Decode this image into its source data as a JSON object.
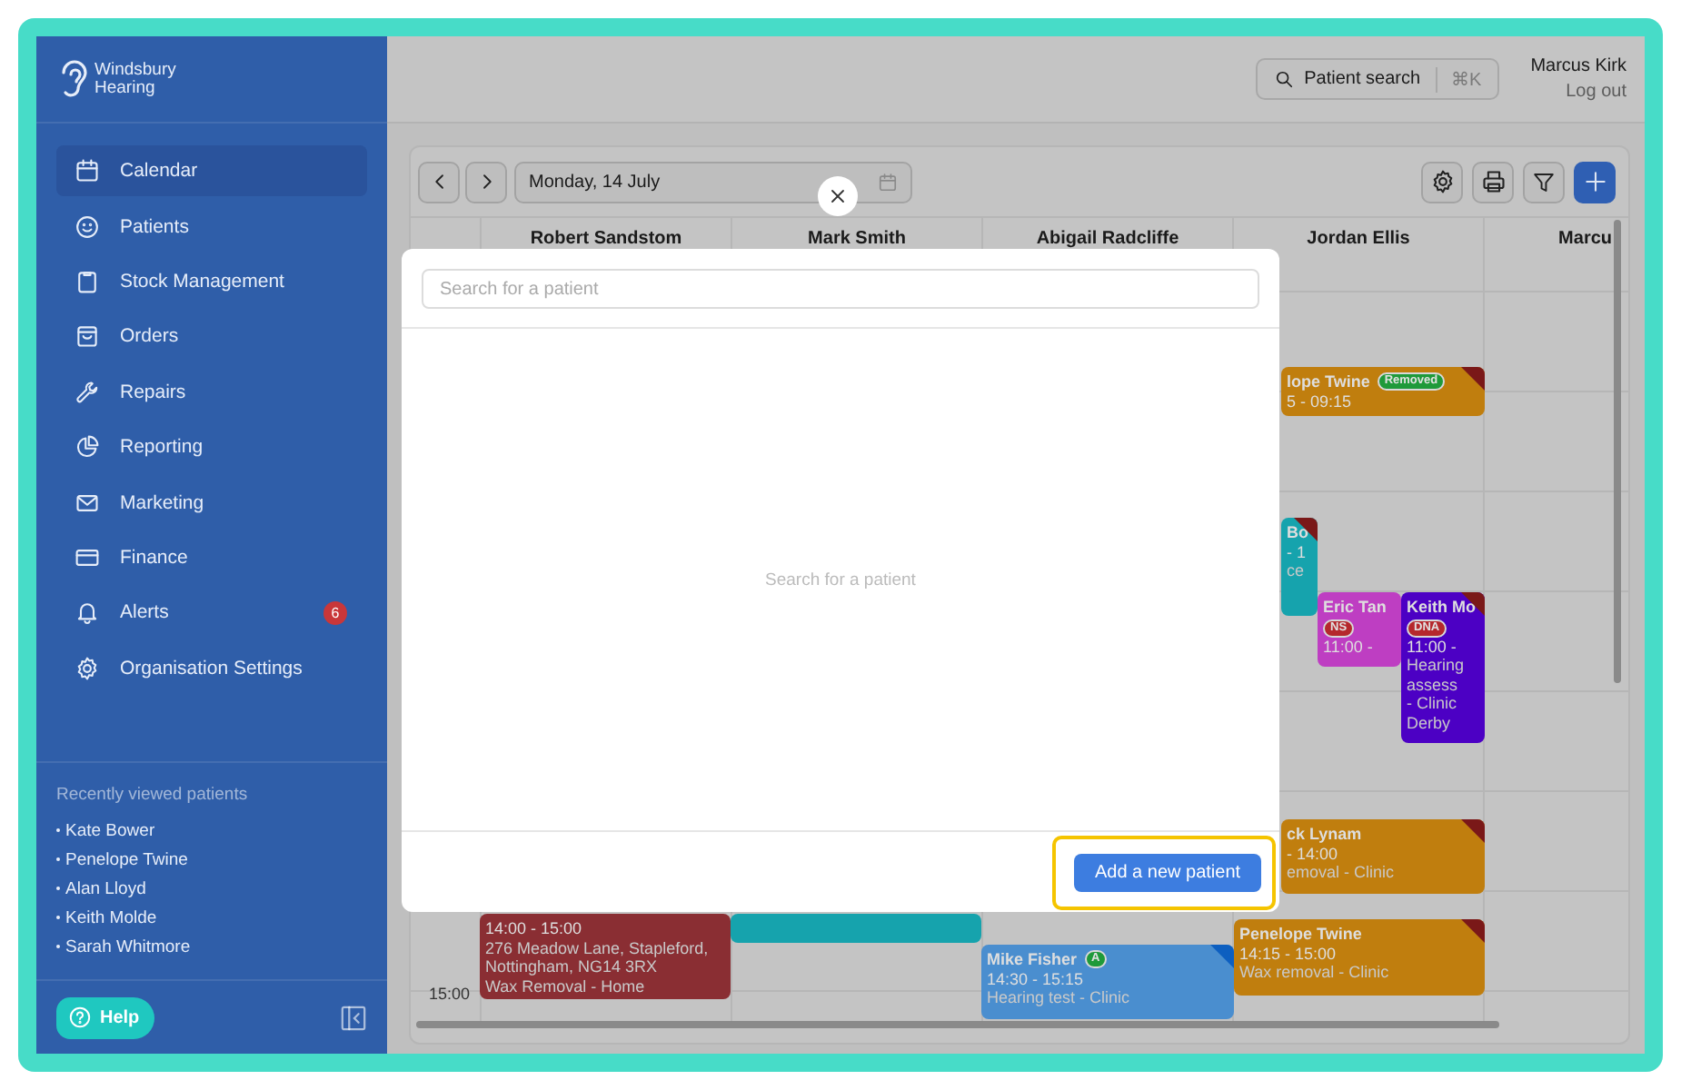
{
  "brand": {
    "lines": [
      "Windsbury",
      "Hearing"
    ]
  },
  "nav": [
    {
      "label": "Calendar",
      "selected": true
    },
    {
      "label": "Patients",
      "selected": false
    },
    {
      "label": "Stock Management",
      "selected": false
    },
    {
      "label": "Orders",
      "selected": false
    },
    {
      "label": "Repairs",
      "selected": false
    },
    {
      "label": "Reporting",
      "selected": false
    },
    {
      "label": "Marketing",
      "selected": false
    },
    {
      "label": "Finance",
      "selected": false
    },
    {
      "label": "Alerts",
      "selected": false,
      "badge": "6"
    },
    {
      "label": "Organisation Settings",
      "selected": false
    }
  ],
  "recent": {
    "title": "Recently viewed patients",
    "patients": [
      "Kate Bower",
      "Penelope Twine",
      "Alan Lloyd",
      "Keith Molde",
      "Sarah Whitmore"
    ]
  },
  "help": {
    "label": "Help"
  },
  "topbar": {
    "search": {
      "label": "Patient search",
      "shortcut": "⌘K"
    },
    "user": {
      "name": "Marcus Kirk",
      "logout": "Log out"
    }
  },
  "calendar": {
    "date": "Monday, 14 July",
    "columns": [
      "Robert Sandstom",
      "Mark Smith",
      "Abigail Radcliffe",
      "Jordan Ellis",
      "Marcu"
    ],
    "times": [
      "15:00"
    ],
    "events": [
      {
        "title": "lope Twine",
        "badge": {
          "text": "Removed",
          "color": "#1f9a3a"
        },
        "lines": [
          "5 - 09:15"
        ],
        "color": "#c07e0e",
        "flag": {
          "color": "#7a1818"
        }
      },
      {
        "title": "Bo",
        "lines": [
          "- 1",
          "ce"
        ],
        "color": "#16a3ad",
        "flag": {
          "color": "#7a1818"
        }
      },
      {
        "title": "Eric Tan",
        "badge": {
          "text": "NS",
          "color": "#b5282d"
        },
        "lines": [
          "11:00 -"
        ],
        "color": "#be3ec2"
      },
      {
        "title": "Keith Mo",
        "badge": {
          "text": "DNA",
          "color": "#b5282d"
        },
        "lines": [
          "11:00 -",
          "Hearing",
          "assess",
          "- Clinic",
          "Derby"
        ],
        "color": "#4c00c4",
        "flag": {
          "color": "#7a1818"
        }
      },
      {
        "title": "ck Lynam",
        "lines": [
          "- 14:00",
          "emoval - Clinic"
        ],
        "color": "#c07e0e",
        "flag": {
          "color": "#7a1818"
        }
      },
      {
        "title": "Penelope Twine",
        "lines": [
          "14:15 - 15:00",
          "Wax removal - Clinic"
        ],
        "color": "#c07e0e",
        "flag": {
          "color": "#7a1818"
        }
      },
      {
        "title": "Mike Fisher",
        "badge": {
          "text": "A",
          "color": "#1f9a3a"
        },
        "lines": [
          "14:30 - 15:15",
          "Hearing test - Clinic"
        ],
        "color": "#4a8ecf",
        "flag": {
          "color": "#0d5fc0"
        }
      },
      {
        "lines": [
          "14:00 - 15:00",
          "276 Meadow Lane, Stapleford,",
          "Nottingham, NG14 3RX",
          "Wax Removal - Home"
        ],
        "color": "#8a2e33"
      },
      {
        "color": "#16a3ad"
      }
    ]
  },
  "modal": {
    "search": {
      "placeholder": "Search for a patient"
    },
    "empty_text": "Search for a patient",
    "button": {
      "label": "Add a new patient",
      "focused": true
    }
  }
}
